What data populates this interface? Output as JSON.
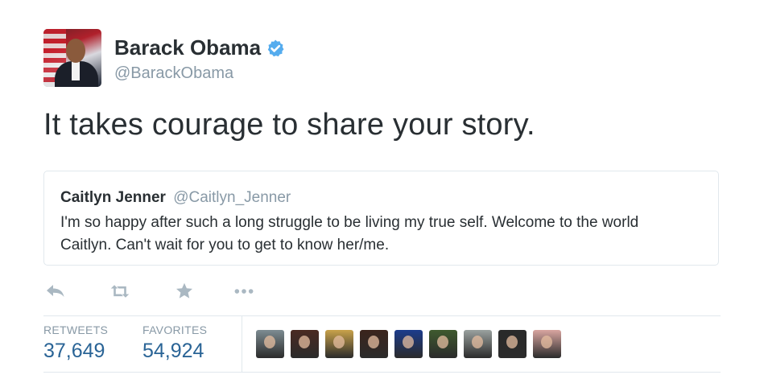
{
  "user": {
    "name": "Barack Obama",
    "handle": "@BarackObama",
    "verified": true
  },
  "tweet": {
    "text": "It takes courage to share your story."
  },
  "quoted_tweet": {
    "name": "Caitlyn Jenner",
    "handle": "@Caitlyn_Jenner",
    "text": "I'm so happy after such a long struggle to be living my true self. Welcome to the world Caitlyn. Can't wait for you to get to know her/me."
  },
  "actions": {
    "icons": [
      "reply-icon",
      "retweet-icon",
      "favorite-icon",
      "more-icon"
    ]
  },
  "stats": {
    "retweets_label": "RETWEETS",
    "retweets_count": "37,649",
    "favorites_label": "FAVORITES",
    "favorites_count": "54,924"
  },
  "favoriters": {
    "count_shown": 9,
    "colors": [
      "#7d8c92",
      "#4a2a22",
      "#c9a24a",
      "#3b241c",
      "#1c3c8c",
      "#3f5a2e",
      "#9aa19f",
      "#2a2a2a",
      "#d9a5a0"
    ]
  },
  "colors": {
    "text": "#292f33",
    "muted": "#8899a6",
    "link": "#2a6496",
    "verified": "#55acee",
    "border": "#e1e8ed",
    "action": "#aab8c2"
  }
}
